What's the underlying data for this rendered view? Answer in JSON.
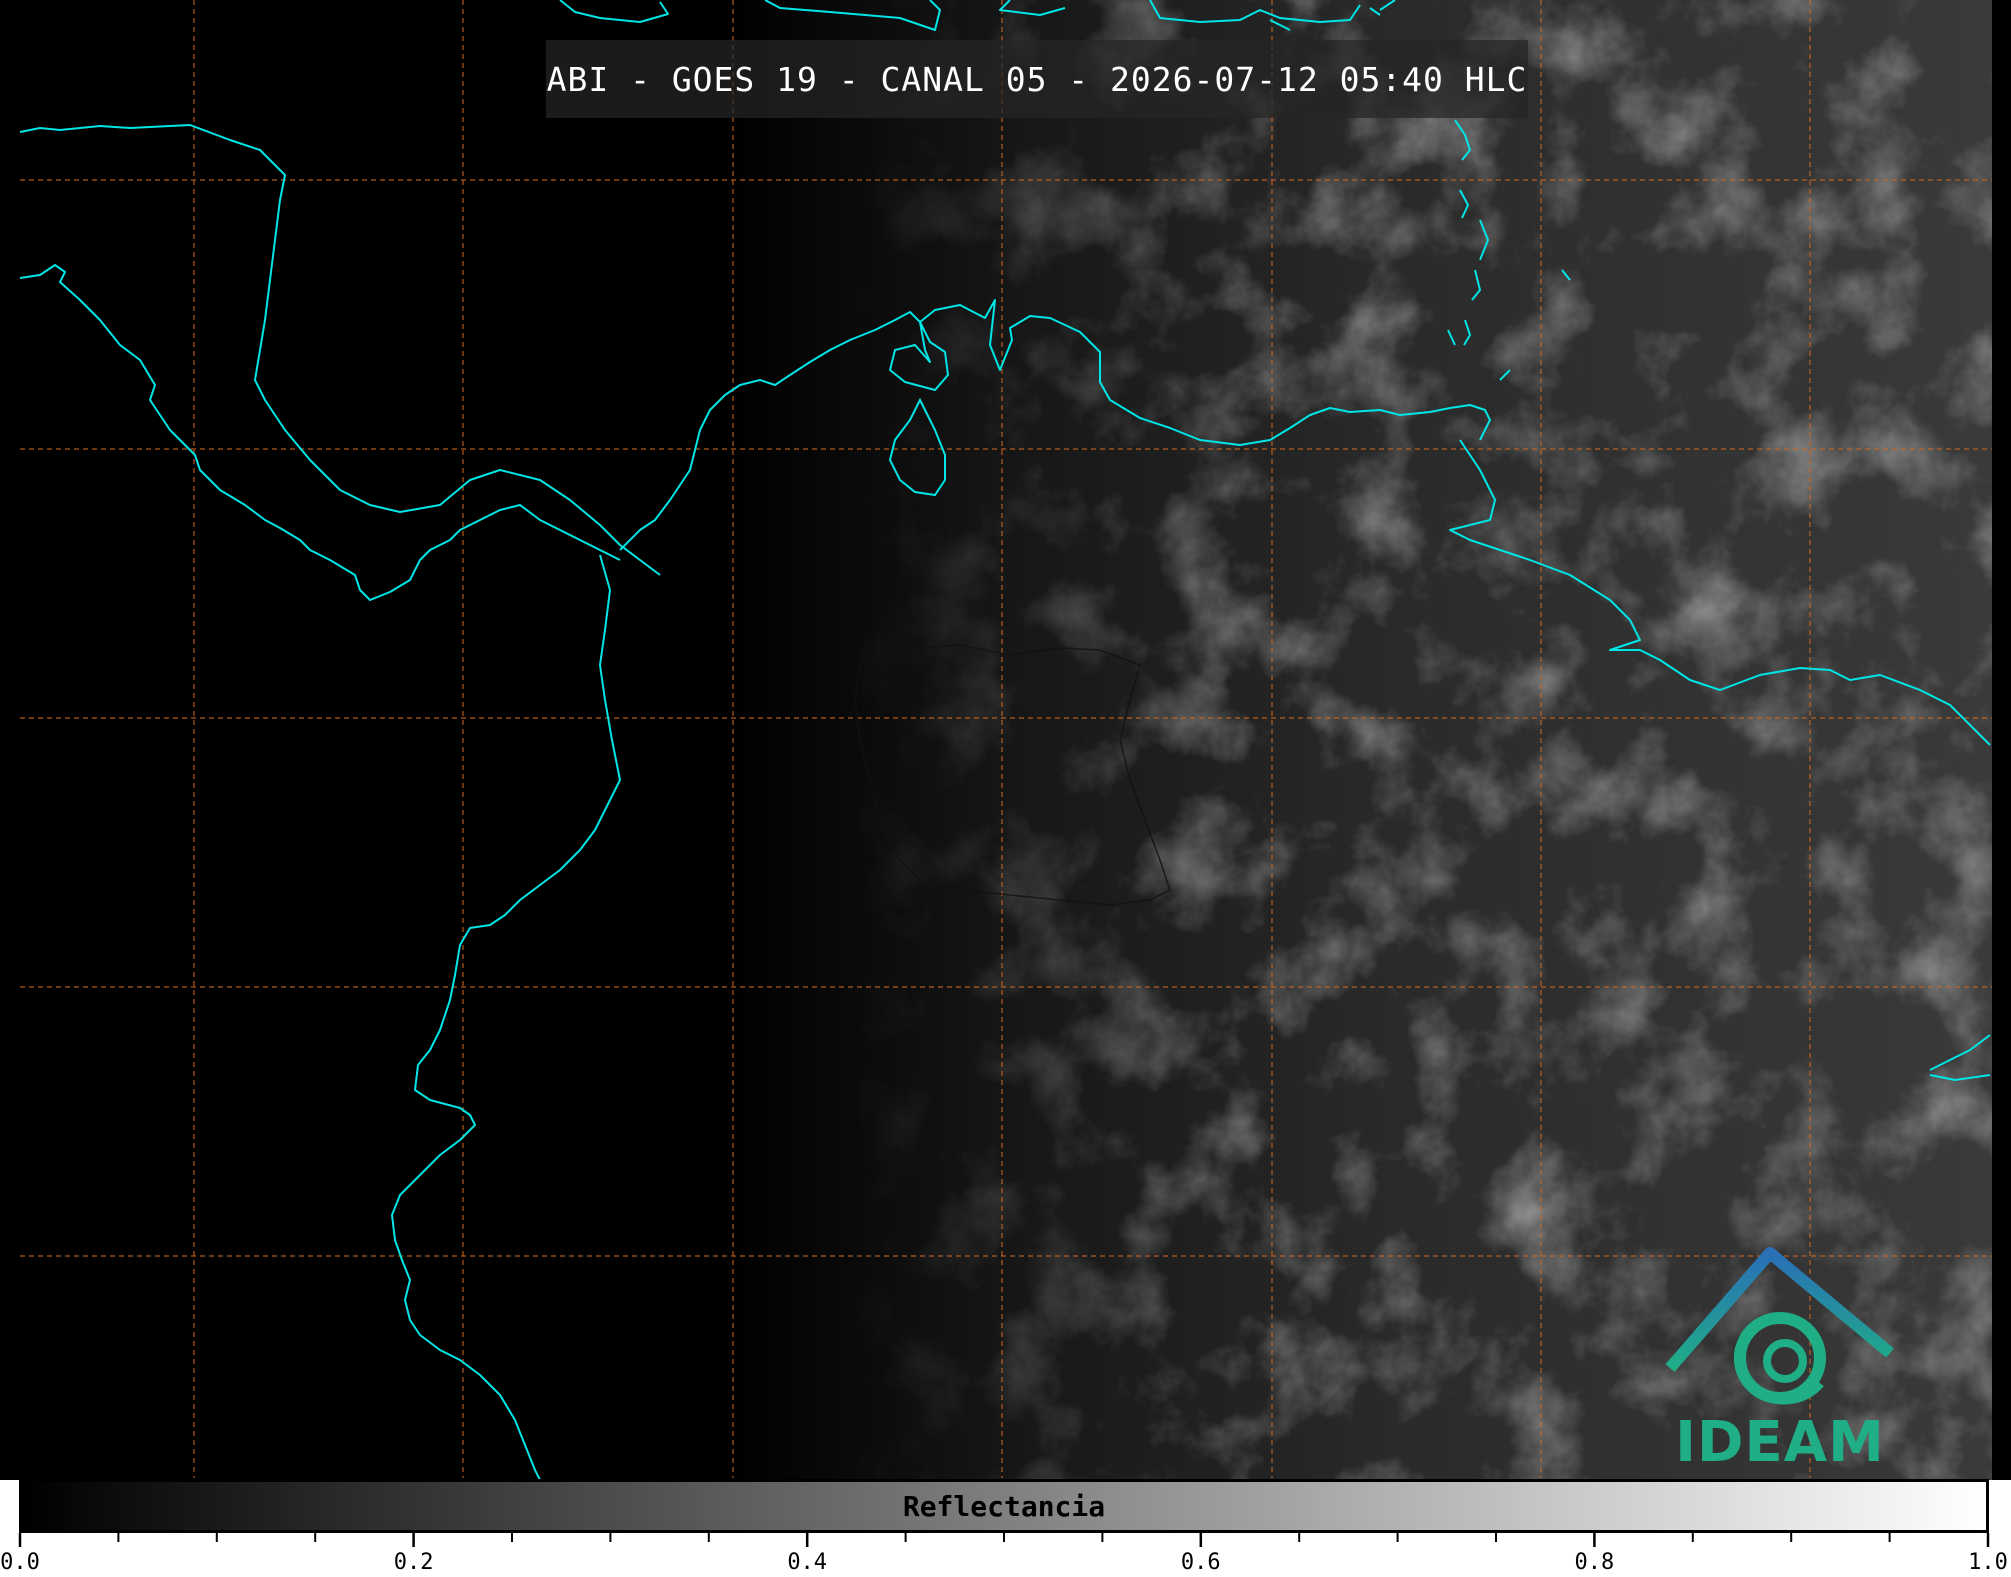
{
  "title": "ABI - GOES 19 - CANAL 05 - 2026-07-12 05:40 HLC",
  "logo": {
    "text": "IDEAM"
  },
  "colorbar": {
    "label": "Reflectancia",
    "range": [
      0.0,
      1.0
    ],
    "major_ticks": [
      "0.0",
      "0.2",
      "0.4",
      "0.6",
      "0.8",
      "1.0"
    ],
    "minor_step": 0.05
  },
  "colors": {
    "coastline": "#00e5e5",
    "gridlines": "#d2691e",
    "background": "#000000",
    "logo_blue": "#2a6fb8",
    "logo_teal": "#1fae86"
  }
}
